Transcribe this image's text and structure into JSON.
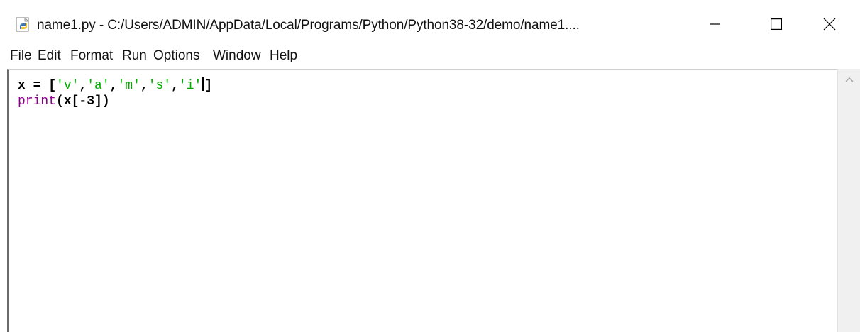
{
  "window": {
    "title": "name1.py - C:/Users/ADMIN/AppData/Local/Programs/Python/Python38-32/demo/name1....",
    "app_icon": "python-idle-icon",
    "controls": {
      "minimize_icon": "minimize-icon",
      "maximize_icon": "maximize-icon",
      "close_icon": "close-icon"
    }
  },
  "menu": {
    "items": [
      "File",
      "Edit",
      "Format",
      "Run",
      "Options",
      "Window",
      "Help"
    ]
  },
  "editor": {
    "line1": {
      "var": "x",
      "op": " = ",
      "open": "[",
      "s1": "'v'",
      "c1": ",",
      "s2": "'a'",
      "c2": ",",
      "s3": "'m'",
      "c3": ",",
      "s4": "'s'",
      "c4": ",",
      "s5": "'i'",
      "close": "]"
    },
    "line2": {
      "func": "print",
      "args": "(x[-3])"
    },
    "colors": {
      "default": "#000000",
      "string": "#00aa00",
      "builtin": "#900090"
    }
  },
  "scrollbar": {
    "up_icon": "scroll-up-arrow-icon"
  }
}
